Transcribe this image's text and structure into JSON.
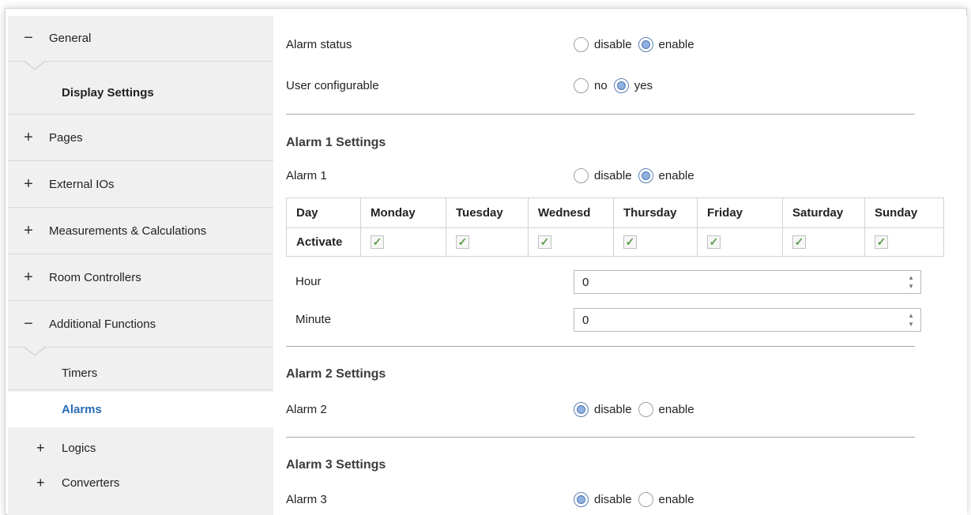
{
  "sidebar": {
    "items": [
      {
        "sign": "−",
        "label": "General"
      },
      {
        "label": "Display Settings"
      },
      {
        "sign": "+",
        "label": "Pages"
      },
      {
        "sign": "+",
        "label": "External IOs"
      },
      {
        "sign": "+",
        "label": "Measurements & Calculations"
      },
      {
        "sign": "+",
        "label": "Room Controllers"
      },
      {
        "sign": "−",
        "label": "Additional Functions"
      },
      {
        "label": "Timers"
      },
      {
        "label": "Alarms"
      },
      {
        "sign": "+",
        "label": "Logics"
      },
      {
        "sign": "+",
        "label": "Converters"
      }
    ]
  },
  "main": {
    "alarm_status": {
      "label": "Alarm status",
      "opt1": "disable",
      "opt2": "enable",
      "selected": "enable"
    },
    "user_configurable": {
      "label": "User configurable",
      "opt1": "no",
      "opt2": "yes",
      "selected": "yes"
    },
    "alarm1": {
      "title": "Alarm 1 Settings",
      "label": "Alarm 1",
      "opt1": "disable",
      "opt2": "enable",
      "selected": "enable",
      "table": {
        "header": [
          "Day",
          "Monday",
          "Tuesday",
          "Wednesd",
          "Thursday",
          "Friday",
          "Saturday",
          "Sunday"
        ],
        "row_label": "Activate",
        "checked": [
          true,
          true,
          true,
          true,
          true,
          true,
          true
        ]
      },
      "hour": {
        "label": "Hour",
        "value": "0"
      },
      "minute": {
        "label": "Minute",
        "value": "0"
      }
    },
    "alarm2": {
      "title": "Alarm 2 Settings",
      "label": "Alarm 2",
      "opt1": "disable",
      "opt2": "enable",
      "selected": "disable"
    },
    "alarm3": {
      "title": "Alarm 3 Settings",
      "label": "Alarm 3",
      "opt1": "disable",
      "opt2": "enable",
      "selected": "disable"
    }
  }
}
